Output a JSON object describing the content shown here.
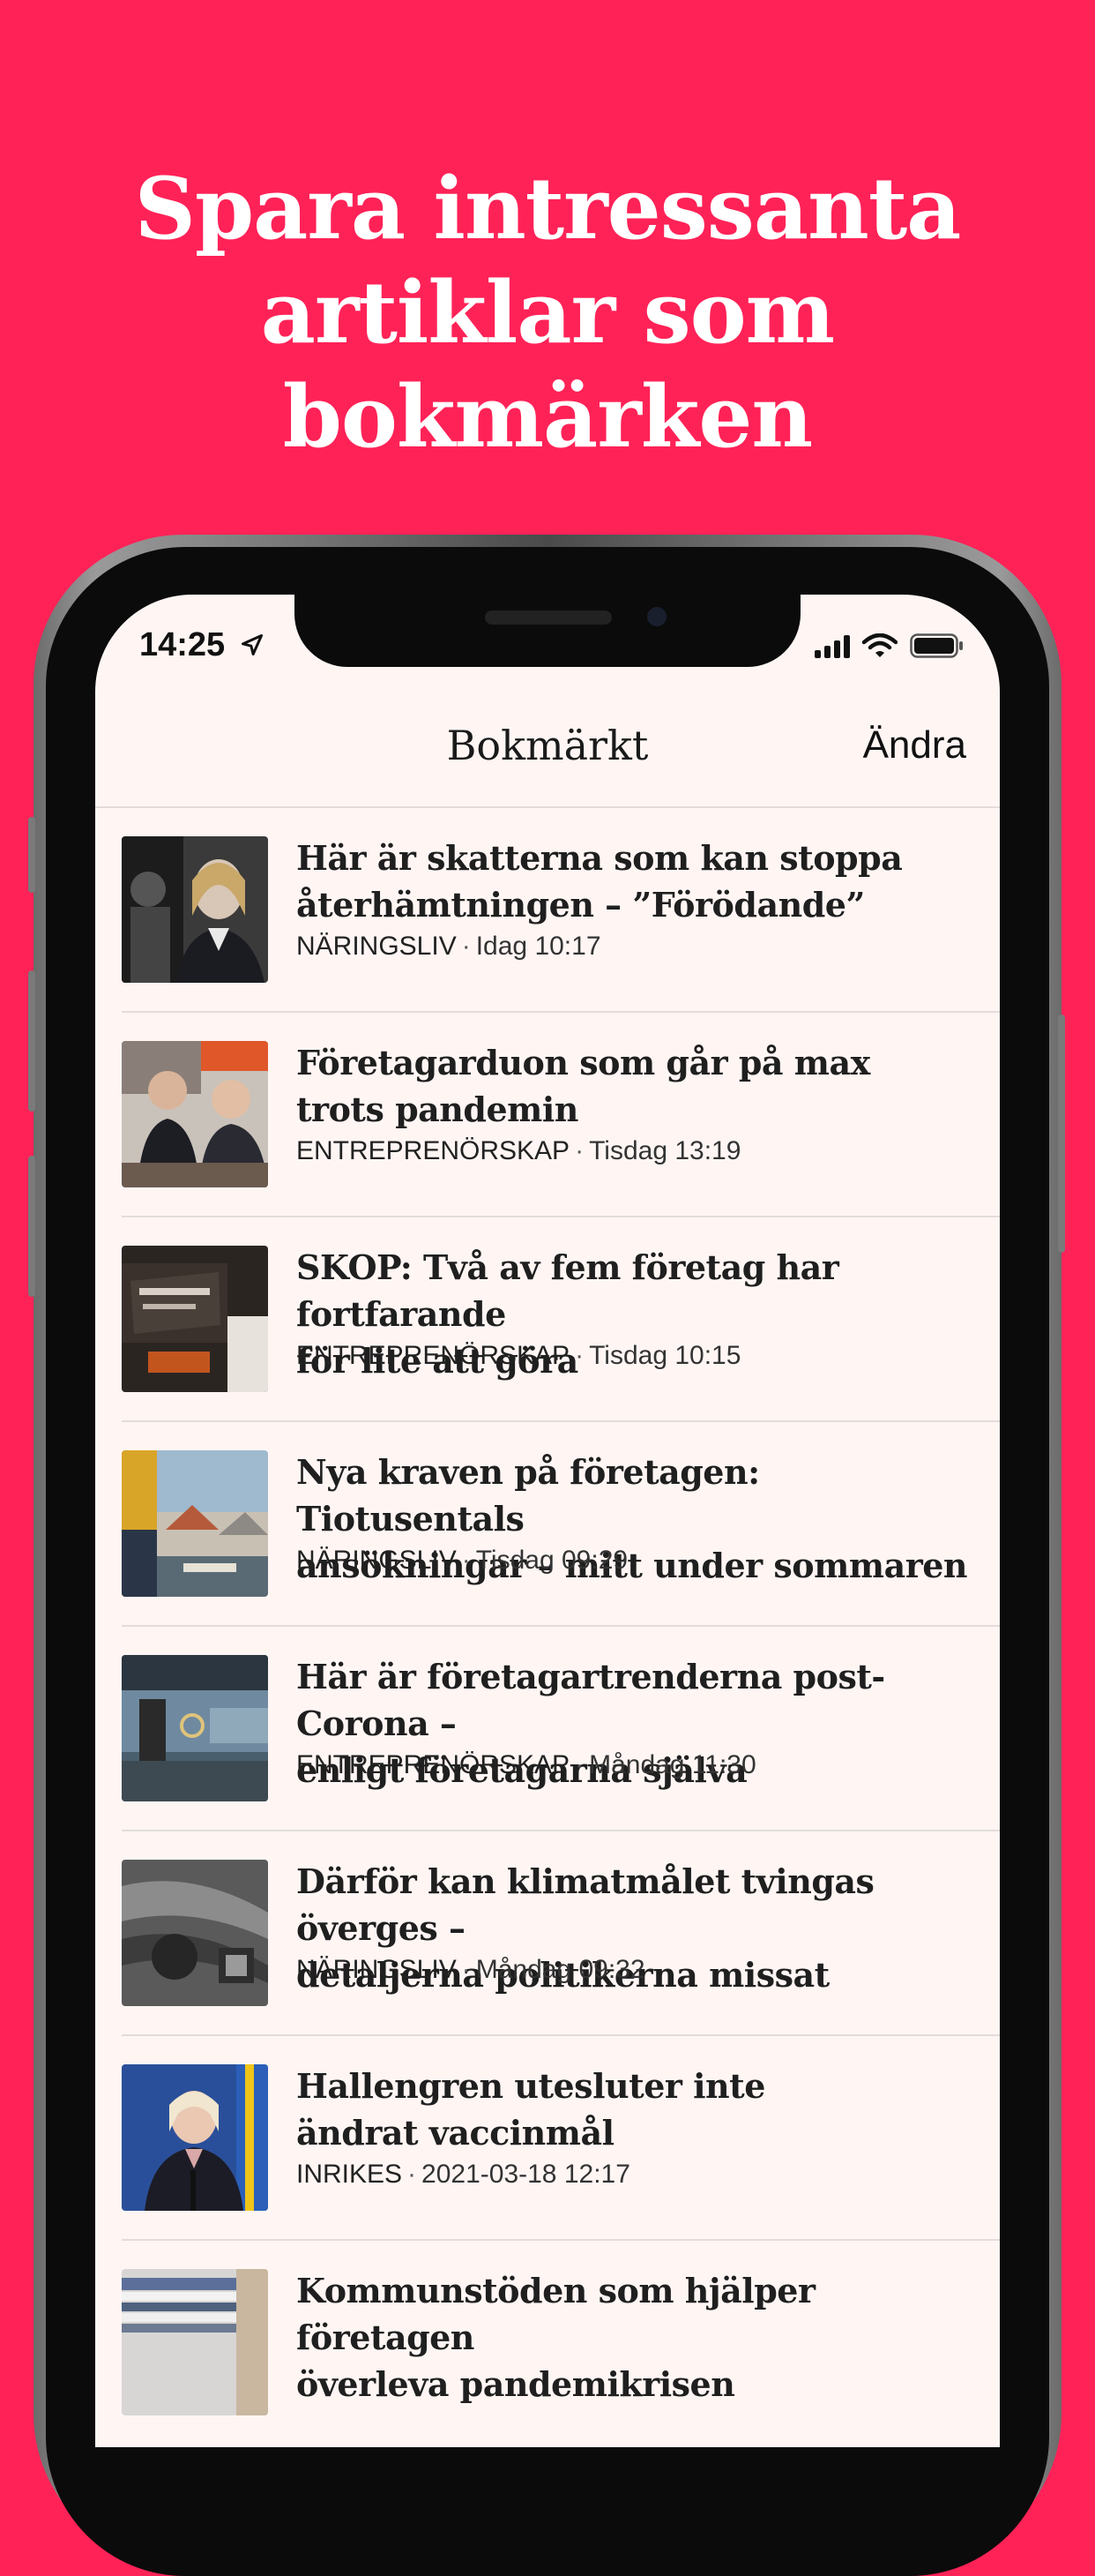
{
  "headline": {
    "line1": "Spara intressanta",
    "line2": "artiklar som bokmärken"
  },
  "status_bar": {
    "time": "14:25",
    "icons": [
      "location-arrow-icon",
      "signal-bars-icon",
      "wifi-icon",
      "battery-icon"
    ]
  },
  "nav": {
    "title": "Bokmärkt",
    "edit_label": "Ändra"
  },
  "colors": {
    "background": "#FF2257",
    "screen": "#FFF6F4",
    "divider": "#E3DCDA"
  },
  "articles": [
    {
      "title_line1": "Här är skatterna som kan stoppa",
      "title_line2": "återhämtningen – ”Förödande”",
      "category": "NÄRINGSLIV",
      "time": "Idag 10:17",
      "thumb": "woman-portrait-bw"
    },
    {
      "title_line1": "Företagarduon som går på max",
      "title_line2": "trots pandemin",
      "category": "ENTREPRENÖRSKAP",
      "time": "Tisdag 13:19",
      "thumb": "two-men-at-table"
    },
    {
      "title_line1": "SKOP: Två av fem företag har fortfarande",
      "title_line2": "för lite att göra",
      "category": "ENTREPRENÖRSKAP",
      "time": "Tisdag 10:15",
      "thumb": "shop-sign-dark"
    },
    {
      "title_line1": "Nya kraven på företagen: Tiotusentals",
      "title_line2": "ansökningar – mitt under sommaren",
      "category": "NÄRINGSLIV",
      "time": "Tisdag 09:29",
      "thumb": "outdoor-market"
    },
    {
      "title_line1": "Här är företagartrenderna post-Corona –",
      "title_line2": "enligt företagarna själva",
      "category": "ENTREPRENÖRSKAP",
      "time": "Måndag 11:30",
      "thumb": "office-interior"
    },
    {
      "title_line1": "Därför kan klimatmålet tvingas överges –",
      "title_line2": "detaljerna politikerna missat",
      "category": "NÄRINGSLIV",
      "time": "Måndag 09:32",
      "thumb": "industrial-bw"
    },
    {
      "title_line1": "Hallengren utesluter inte",
      "title_line2": "ändrat vaccinmål",
      "category": "INRIKES",
      "time": "2021-03-18 12:17",
      "thumb": "woman-at-podium"
    },
    {
      "title_line1": "Kommunstöden som hjälper företagen",
      "title_line2": "överleva pandemikrisen",
      "category": "",
      "time": "",
      "thumb": "paper-stacks"
    }
  ]
}
